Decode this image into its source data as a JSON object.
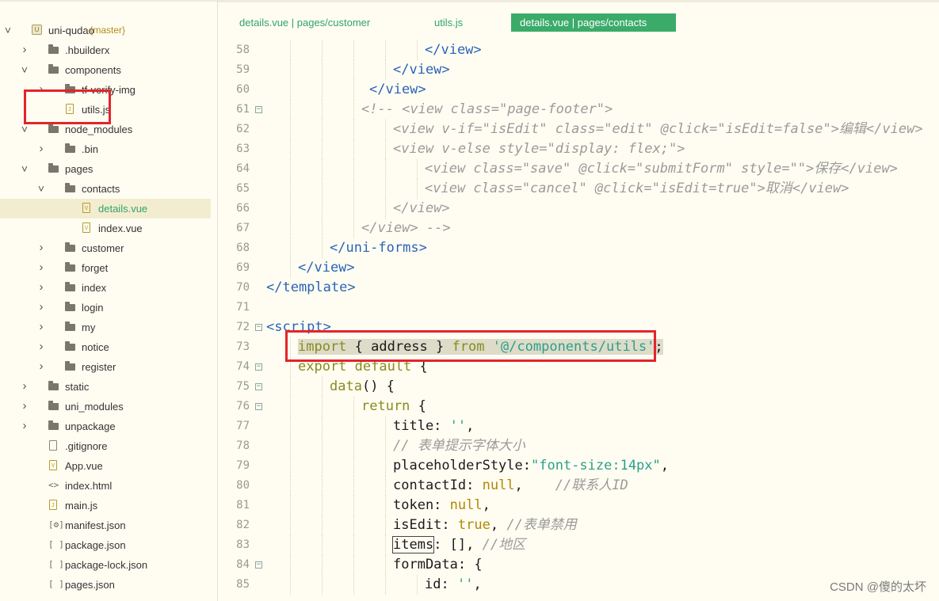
{
  "tabs": [
    {
      "label": "details.vue | pages/customer",
      "active": false
    },
    {
      "label": "utils.js",
      "active": false
    },
    {
      "label": "details.vue | pages/contacts",
      "active": true
    }
  ],
  "tree": [
    {
      "label": "uni-qudao",
      "branch": "- {master}",
      "type": "project",
      "depth": 0,
      "chev": "down"
    },
    {
      "label": ".hbuilderx",
      "type": "folder",
      "depth": 1,
      "chev": "right"
    },
    {
      "label": "components",
      "type": "folder",
      "depth": 1,
      "chev": "down"
    },
    {
      "label": "tf-verify-img",
      "type": "folder",
      "depth": 2,
      "chev": "right"
    },
    {
      "label": "utils.js",
      "type": "js",
      "depth": 2,
      "chev": ""
    },
    {
      "label": "node_modules",
      "type": "folder",
      "depth": 1,
      "chev": "down"
    },
    {
      "label": ".bin",
      "type": "folder",
      "depth": 2,
      "chev": "right"
    },
    {
      "label": "pages",
      "type": "folder",
      "depth": 1,
      "chev": "down"
    },
    {
      "label": "contacts",
      "type": "folder",
      "depth": 2,
      "chev": "down"
    },
    {
      "label": "details.vue",
      "type": "vue",
      "depth": 3,
      "chev": "",
      "selected": true
    },
    {
      "label": "index.vue",
      "type": "vue",
      "depth": 3,
      "chev": ""
    },
    {
      "label": "customer",
      "type": "folder",
      "depth": 2,
      "chev": "right"
    },
    {
      "label": "forget",
      "type": "folder",
      "depth": 2,
      "chev": "right"
    },
    {
      "label": "index",
      "type": "folder",
      "depth": 2,
      "chev": "right"
    },
    {
      "label": "login",
      "type": "folder",
      "depth": 2,
      "chev": "right"
    },
    {
      "label": "my",
      "type": "folder",
      "depth": 2,
      "chev": "right"
    },
    {
      "label": "notice",
      "type": "folder",
      "depth": 2,
      "chev": "right"
    },
    {
      "label": "register",
      "type": "folder",
      "depth": 2,
      "chev": "right"
    },
    {
      "label": "static",
      "type": "folder",
      "depth": 1,
      "chev": "right"
    },
    {
      "label": "uni_modules",
      "type": "folder",
      "depth": 1,
      "chev": "right"
    },
    {
      "label": "unpackage",
      "type": "folder",
      "depth": 1,
      "chev": "right"
    },
    {
      "label": ".gitignore",
      "type": "file",
      "depth": 1,
      "chev": ""
    },
    {
      "label": "App.vue",
      "type": "vue",
      "depth": 1,
      "chev": ""
    },
    {
      "label": "index.html",
      "type": "html",
      "depth": 1,
      "chev": ""
    },
    {
      "label": "main.js",
      "type": "js",
      "depth": 1,
      "chev": ""
    },
    {
      "label": "manifest.json",
      "type": "json-gear",
      "depth": 1,
      "chev": ""
    },
    {
      "label": "package.json",
      "type": "json",
      "depth": 1,
      "chev": ""
    },
    {
      "label": "package-lock.json",
      "type": "json",
      "depth": 1,
      "chev": ""
    },
    {
      "label": "pages.json",
      "type": "json",
      "depth": 1,
      "chev": ""
    }
  ],
  "code_lines": [
    {
      "n": "58",
      "fold": false,
      "indent": 5,
      "tokens": [
        [
          "tag",
          "</view>"
        ]
      ]
    },
    {
      "n": "59",
      "fold": false,
      "indent": 4,
      "tokens": [
        [
          "tag",
          "</view>"
        ]
      ]
    },
    {
      "n": "60",
      "fold": false,
      "indent": 3.25,
      "tokens": [
        [
          "tag",
          "</view>"
        ]
      ]
    },
    {
      "n": "61",
      "fold": true,
      "indent": 3,
      "tokens": [
        [
          "com",
          "<!-- <view class=\"page-footer\">"
        ]
      ]
    },
    {
      "n": "62",
      "fold": false,
      "indent": 4,
      "tokens": [
        [
          "com",
          "<view v-if=\"isEdit\" class=\"edit\" @click=\"isEdit=false\">编辑</view>"
        ]
      ]
    },
    {
      "n": "63",
      "fold": false,
      "indent": 4,
      "tokens": [
        [
          "com",
          "<view v-else style=\"display: flex;\">"
        ]
      ]
    },
    {
      "n": "64",
      "fold": false,
      "indent": 5,
      "tokens": [
        [
          "com",
          "<view class=\"save\" @click=\"submitForm\" style=\"\">保存</view>"
        ]
      ]
    },
    {
      "n": "65",
      "fold": false,
      "indent": 5,
      "tokens": [
        [
          "com",
          "<view class=\"cancel\" @click=\"isEdit=true\">取消</view>"
        ]
      ]
    },
    {
      "n": "66",
      "fold": false,
      "indent": 4,
      "tokens": [
        [
          "com",
          "</view>"
        ]
      ]
    },
    {
      "n": "67",
      "fold": false,
      "indent": 3,
      "tokens": [
        [
          "com",
          "</view> -->"
        ]
      ]
    },
    {
      "n": "68",
      "fold": false,
      "indent": 2,
      "tokens": [
        [
          "tag",
          "</uni-forms>"
        ]
      ]
    },
    {
      "n": "69",
      "fold": false,
      "indent": 1,
      "tokens": [
        [
          "tag",
          "</view>"
        ]
      ]
    },
    {
      "n": "70",
      "fold": false,
      "indent": 0,
      "tokens": [
        [
          "tag",
          "</template>"
        ]
      ]
    },
    {
      "n": "71",
      "fold": false,
      "indent": 0,
      "tokens": []
    },
    {
      "n": "72",
      "fold": true,
      "indent": 0,
      "tokens": [
        [
          "tag",
          "<script>"
        ]
      ]
    },
    {
      "n": "73",
      "fold": false,
      "indent": 1,
      "highlight": true,
      "tokens": [
        [
          "kw",
          "import"
        ],
        [
          "plain",
          " { address } "
        ],
        [
          "kw",
          "from"
        ],
        [
          "plain",
          " "
        ],
        [
          "str",
          "'@/components/utils'"
        ],
        [
          "plain",
          ";"
        ]
      ]
    },
    {
      "n": "74",
      "fold": true,
      "indent": 1,
      "tokens": [
        [
          "kw",
          "export default"
        ],
        [
          "plain",
          " {"
        ]
      ]
    },
    {
      "n": "75",
      "fold": true,
      "indent": 2,
      "tokens": [
        [
          "kw",
          "data"
        ],
        [
          "plain",
          "() {"
        ]
      ]
    },
    {
      "n": "76",
      "fold": true,
      "indent": 3,
      "tokens": [
        [
          "kw",
          "return"
        ],
        [
          "plain",
          " {"
        ]
      ]
    },
    {
      "n": "77",
      "fold": false,
      "indent": 4,
      "tokens": [
        [
          "plain",
          "title: "
        ],
        [
          "str",
          "''"
        ],
        [
          "plain",
          ","
        ]
      ]
    },
    {
      "n": "78",
      "fold": false,
      "indent": 4,
      "tokens": [
        [
          "com",
          "// 表单提示字体大小"
        ]
      ]
    },
    {
      "n": "79",
      "fold": false,
      "indent": 4,
      "tokens": [
        [
          "plain",
          "placeholderStyle:"
        ],
        [
          "str",
          "\"font-size:14px\""
        ],
        [
          "plain",
          ","
        ]
      ]
    },
    {
      "n": "80",
      "fold": false,
      "indent": 4,
      "tokens": [
        [
          "plain",
          "contactId: "
        ],
        [
          "lit",
          "null"
        ],
        [
          "plain",
          ",    "
        ],
        [
          "com",
          "//联系人ID"
        ]
      ]
    },
    {
      "n": "81",
      "fold": false,
      "indent": 4,
      "tokens": [
        [
          "plain",
          "token: "
        ],
        [
          "lit",
          "null"
        ],
        [
          "plain",
          ","
        ]
      ]
    },
    {
      "n": "82",
      "fold": false,
      "indent": 4,
      "tokens": [
        [
          "plain",
          "isEdit: "
        ],
        [
          "lit",
          "true"
        ],
        [
          "plain",
          ", "
        ],
        [
          "com",
          "//表单禁用"
        ]
      ]
    },
    {
      "n": "83",
      "fold": false,
      "indent": 4,
      "tokens": [
        [
          "boxed",
          "items"
        ],
        [
          "plain",
          ": [], "
        ],
        [
          "com",
          "//地区"
        ]
      ]
    },
    {
      "n": "84",
      "fold": true,
      "indent": 4,
      "tokens": [
        [
          "plain",
          "formData: {"
        ]
      ]
    },
    {
      "n": "85",
      "fold": false,
      "indent": 5,
      "tokens": [
        [
          "plain",
          "id: "
        ],
        [
          "str",
          "''"
        ],
        [
          "plain",
          ","
        ]
      ]
    }
  ],
  "watermark": "CSDN @傻的太坏"
}
